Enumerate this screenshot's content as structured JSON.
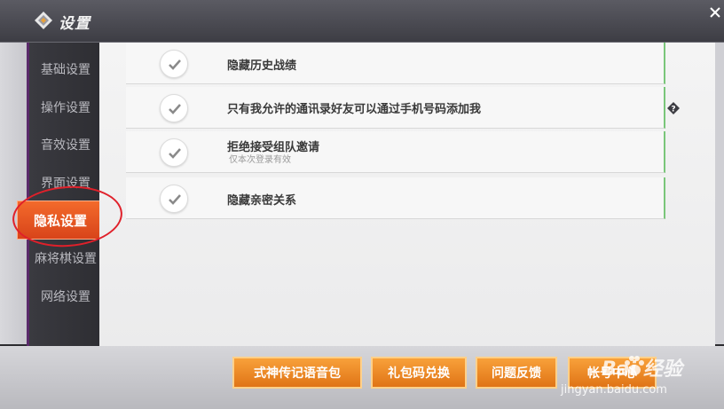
{
  "header": {
    "title": "设置",
    "logo_icon": "diamond-logo-icon",
    "close_icon": "close-icon"
  },
  "sidebar": {
    "items": [
      {
        "label": "基础设置",
        "active": false
      },
      {
        "label": "操作设置",
        "active": false
      },
      {
        "label": "音效设置",
        "active": false
      },
      {
        "label": "界面设置",
        "active": false
      },
      {
        "label": "隐私设置",
        "active": true
      },
      {
        "label": "麻将棋设置",
        "active": false
      },
      {
        "label": "网络设置",
        "active": false
      }
    ]
  },
  "privacy_options": [
    {
      "label": "隐藏历史战绩",
      "checked": true
    },
    {
      "label": "只有我允许的通讯录好友可以通过手机号码添加我",
      "checked": true,
      "has_help": true
    },
    {
      "label": "拒绝接受组队邀请",
      "sublabel": "仅本次登录有效",
      "checked": true
    },
    {
      "label": "隐藏亲密关系",
      "checked": true
    }
  ],
  "bottom_buttons": [
    {
      "label": "式神传记语音包"
    },
    {
      "label": "礼包码兑换"
    },
    {
      "label": "问题反馈"
    },
    {
      "label": "帐号中心"
    }
  ],
  "watermark": {
    "brand": "Bai 经验",
    "url": "jingyan.baidu.com"
  },
  "colors": {
    "accent_orange": "#f36a2b",
    "button_orange": "#f39330",
    "check_green_edge": "#7ac67a"
  }
}
